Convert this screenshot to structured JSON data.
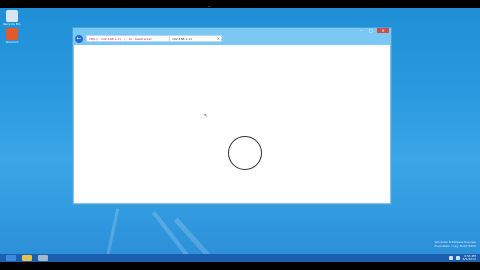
{
  "topbar": {
    "close_glyph": "—"
  },
  "desktop": {
    "icons": [
      {
        "name": "recycle-bin-icon",
        "label": "Recycle Bin",
        "color": "#d8e6f2"
      },
      {
        "name": "app-icon",
        "label": "Shortcut",
        "color": "#e05a2b"
      }
    ]
  },
  "browser": {
    "back_glyph": "←",
    "address": "http:// · 192.168.1.11 · ◇ · fe · tasktracker",
    "tab_label": "192.168.1.11",
    "tab_close_glyph": "×",
    "minimize_glyph": "–",
    "maximize_glyph": "□",
    "close_glyph": "✕",
    "cursor_glyph": "↖"
  },
  "watermark": {
    "line1": "Windows 8 Release Preview",
    "line2": "Evaluation copy. Build 8400"
  },
  "taskbar": {
    "apps": [
      {
        "name": "internet-explorer-icon",
        "color": "#3b8be0"
      },
      {
        "name": "file-explorer-icon",
        "color": "#e8c14a"
      },
      {
        "name": "recycle-icon",
        "color": "#9fb8cf"
      }
    ],
    "time": "4:54 PM",
    "date": "6/5/2012"
  },
  "colors": {
    "desktop": "#2a9be0",
    "taskbar": "#1b5fae",
    "address_text": "#c2185b"
  }
}
